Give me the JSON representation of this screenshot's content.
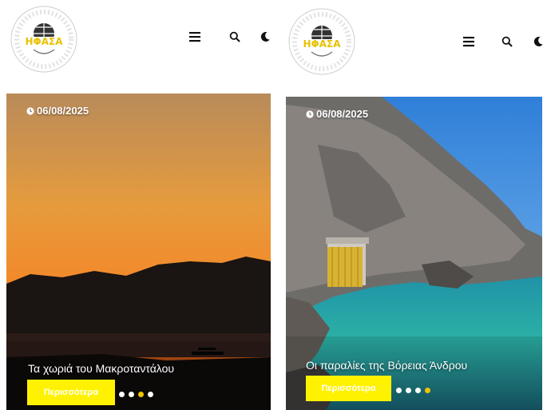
{
  "colors": {
    "accent_yellow": "#fff200",
    "dot_active": "#f2c400",
    "dot_inactive": "#ffffff",
    "header_bg": "#ffffff",
    "icon_color": "#111111"
  },
  "icons": {
    "menu": "menu-icon",
    "search": "search-icon",
    "theme": "moon-icon",
    "date": "clock-icon"
  },
  "panels": [
    {
      "logo_text": "ΗΦΑΣΑ",
      "card": {
        "date": "06/08/2025",
        "title": "Τα χωριά του Μακροταντάλου",
        "button_label": "Περισσότερα",
        "slides_total": 4,
        "active_slide": 3
      }
    },
    {
      "logo_text": "ΗΦΑΣΑ",
      "card": {
        "date": "06/08/2025",
        "title": "Οι παραλίες της Βόρειας Άνδρου",
        "button_label": "Περισσότερα",
        "slides_total": 4,
        "active_slide": 4
      }
    }
  ]
}
